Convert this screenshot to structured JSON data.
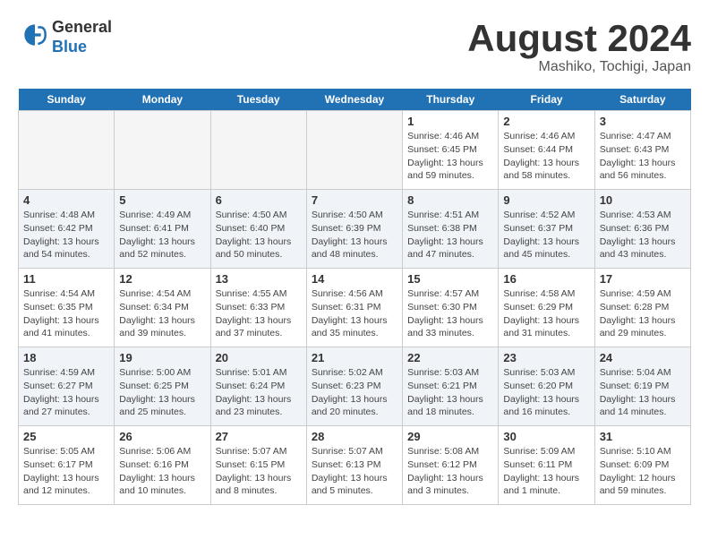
{
  "header": {
    "logo_line1": "General",
    "logo_line2": "Blue",
    "month_title": "August 2024",
    "location": "Mashiko, Tochigi, Japan"
  },
  "weekdays": [
    "Sunday",
    "Monday",
    "Tuesday",
    "Wednesday",
    "Thursday",
    "Friday",
    "Saturday"
  ],
  "weeks": [
    [
      {
        "day": "",
        "info": ""
      },
      {
        "day": "",
        "info": ""
      },
      {
        "day": "",
        "info": ""
      },
      {
        "day": "",
        "info": ""
      },
      {
        "day": "1",
        "info": "Sunrise: 4:46 AM\nSunset: 6:45 PM\nDaylight: 13 hours\nand 59 minutes."
      },
      {
        "day": "2",
        "info": "Sunrise: 4:46 AM\nSunset: 6:44 PM\nDaylight: 13 hours\nand 58 minutes."
      },
      {
        "day": "3",
        "info": "Sunrise: 4:47 AM\nSunset: 6:43 PM\nDaylight: 13 hours\nand 56 minutes."
      }
    ],
    [
      {
        "day": "4",
        "info": "Sunrise: 4:48 AM\nSunset: 6:42 PM\nDaylight: 13 hours\nand 54 minutes."
      },
      {
        "day": "5",
        "info": "Sunrise: 4:49 AM\nSunset: 6:41 PM\nDaylight: 13 hours\nand 52 minutes."
      },
      {
        "day": "6",
        "info": "Sunrise: 4:50 AM\nSunset: 6:40 PM\nDaylight: 13 hours\nand 50 minutes."
      },
      {
        "day": "7",
        "info": "Sunrise: 4:50 AM\nSunset: 6:39 PM\nDaylight: 13 hours\nand 48 minutes."
      },
      {
        "day": "8",
        "info": "Sunrise: 4:51 AM\nSunset: 6:38 PM\nDaylight: 13 hours\nand 47 minutes."
      },
      {
        "day": "9",
        "info": "Sunrise: 4:52 AM\nSunset: 6:37 PM\nDaylight: 13 hours\nand 45 minutes."
      },
      {
        "day": "10",
        "info": "Sunrise: 4:53 AM\nSunset: 6:36 PM\nDaylight: 13 hours\nand 43 minutes."
      }
    ],
    [
      {
        "day": "11",
        "info": "Sunrise: 4:54 AM\nSunset: 6:35 PM\nDaylight: 13 hours\nand 41 minutes."
      },
      {
        "day": "12",
        "info": "Sunrise: 4:54 AM\nSunset: 6:34 PM\nDaylight: 13 hours\nand 39 minutes."
      },
      {
        "day": "13",
        "info": "Sunrise: 4:55 AM\nSunset: 6:33 PM\nDaylight: 13 hours\nand 37 minutes."
      },
      {
        "day": "14",
        "info": "Sunrise: 4:56 AM\nSunset: 6:31 PM\nDaylight: 13 hours\nand 35 minutes."
      },
      {
        "day": "15",
        "info": "Sunrise: 4:57 AM\nSunset: 6:30 PM\nDaylight: 13 hours\nand 33 minutes."
      },
      {
        "day": "16",
        "info": "Sunrise: 4:58 AM\nSunset: 6:29 PM\nDaylight: 13 hours\nand 31 minutes."
      },
      {
        "day": "17",
        "info": "Sunrise: 4:59 AM\nSunset: 6:28 PM\nDaylight: 13 hours\nand 29 minutes."
      }
    ],
    [
      {
        "day": "18",
        "info": "Sunrise: 4:59 AM\nSunset: 6:27 PM\nDaylight: 13 hours\nand 27 minutes."
      },
      {
        "day": "19",
        "info": "Sunrise: 5:00 AM\nSunset: 6:25 PM\nDaylight: 13 hours\nand 25 minutes."
      },
      {
        "day": "20",
        "info": "Sunrise: 5:01 AM\nSunset: 6:24 PM\nDaylight: 13 hours\nand 23 minutes."
      },
      {
        "day": "21",
        "info": "Sunrise: 5:02 AM\nSunset: 6:23 PM\nDaylight: 13 hours\nand 20 minutes."
      },
      {
        "day": "22",
        "info": "Sunrise: 5:03 AM\nSunset: 6:21 PM\nDaylight: 13 hours\nand 18 minutes."
      },
      {
        "day": "23",
        "info": "Sunrise: 5:03 AM\nSunset: 6:20 PM\nDaylight: 13 hours\nand 16 minutes."
      },
      {
        "day": "24",
        "info": "Sunrise: 5:04 AM\nSunset: 6:19 PM\nDaylight: 13 hours\nand 14 minutes."
      }
    ],
    [
      {
        "day": "25",
        "info": "Sunrise: 5:05 AM\nSunset: 6:17 PM\nDaylight: 13 hours\nand 12 minutes."
      },
      {
        "day": "26",
        "info": "Sunrise: 5:06 AM\nSunset: 6:16 PM\nDaylight: 13 hours\nand 10 minutes."
      },
      {
        "day": "27",
        "info": "Sunrise: 5:07 AM\nSunset: 6:15 PM\nDaylight: 13 hours\nand 8 minutes."
      },
      {
        "day": "28",
        "info": "Sunrise: 5:07 AM\nSunset: 6:13 PM\nDaylight: 13 hours\nand 5 minutes."
      },
      {
        "day": "29",
        "info": "Sunrise: 5:08 AM\nSunset: 6:12 PM\nDaylight: 13 hours\nand 3 minutes."
      },
      {
        "day": "30",
        "info": "Sunrise: 5:09 AM\nSunset: 6:11 PM\nDaylight: 13 hours\nand 1 minute."
      },
      {
        "day": "31",
        "info": "Sunrise: 5:10 AM\nSunset: 6:09 PM\nDaylight: 12 hours\nand 59 minutes."
      }
    ]
  ]
}
